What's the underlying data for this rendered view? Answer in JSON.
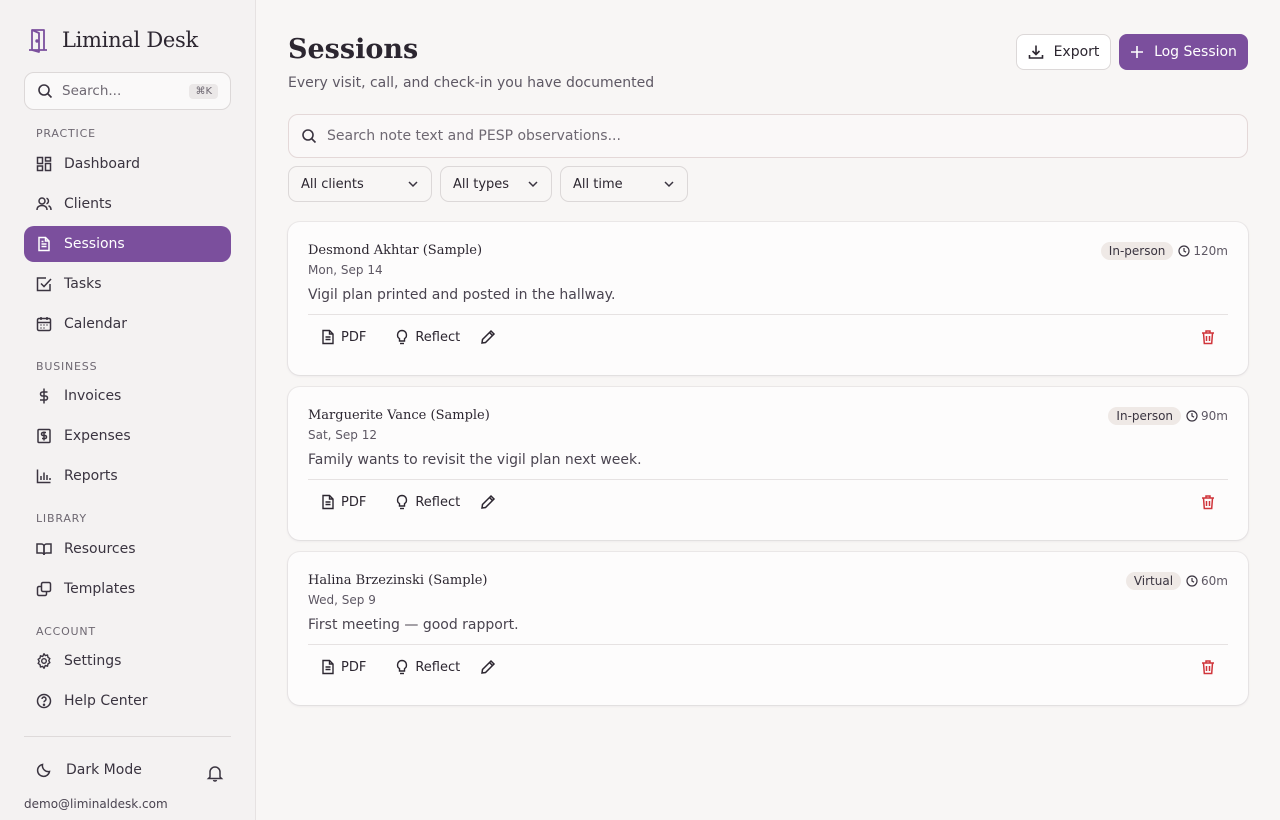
{
  "app": {
    "name": "Liminal Desk"
  },
  "sidebar": {
    "search_placeholder": "Search...",
    "search_shortcut": "⌘K",
    "sections": {
      "practice": "PRACTICE",
      "business": "BUSINESS",
      "library": "LIBRARY",
      "account": "ACCOUNT"
    },
    "items": {
      "dashboard": "Dashboard",
      "clients": "Clients",
      "sessions": "Sessions",
      "tasks": "Tasks",
      "calendar": "Calendar",
      "invoices": "Invoices",
      "expenses": "Expenses",
      "reports": "Reports",
      "resources": "Resources",
      "templates": "Templates",
      "settings": "Settings",
      "help": "Help Center"
    },
    "dark_mode_label": "Dark Mode",
    "user_email": "demo@liminaldesk.com"
  },
  "header": {
    "title": "Sessions",
    "subtitle": "Every visit, call, and check-in you have documented",
    "export_label": "Export",
    "log_label": "Log Session"
  },
  "search": {
    "placeholder": "Search note text and PESP observations..."
  },
  "filters": {
    "clients": "All clients",
    "types": "All types",
    "time": "All time"
  },
  "sessions": [
    {
      "client": "Desmond Akhtar (Sample)",
      "date": "Mon, Sep 14",
      "type": "In-person",
      "duration": "120m",
      "note": "Vigil plan printed and posted in the hallway."
    },
    {
      "client": "Marguerite Vance (Sample)",
      "date": "Sat, Sep 12",
      "type": "In-person",
      "duration": "90m",
      "note": "Family wants to revisit the vigil plan next week."
    },
    {
      "client": "Halina Brzezinski (Sample)",
      "date": "Wed, Sep 9",
      "type": "Virtual",
      "duration": "60m",
      "note": "First meeting — good rapport."
    }
  ],
  "card_actions": {
    "pdf": "PDF",
    "reflect": "Reflect"
  },
  "colors": {
    "accent": "#7b4f9d",
    "danger": "#d0343a"
  }
}
